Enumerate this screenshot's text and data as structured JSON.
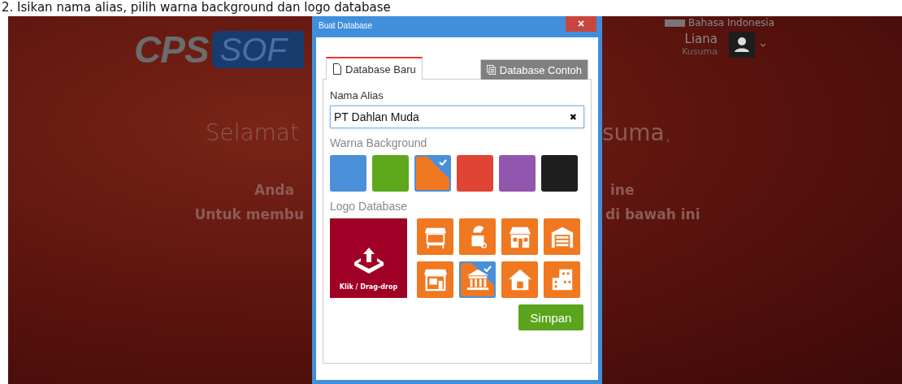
{
  "caption": "2.  Isikan nama alias, pilih warna background dan logo database",
  "header": {
    "logo_left": "CPS",
    "logo_right": "SOF",
    "language": "Bahasa Indonesia",
    "user_first": "Liana",
    "user_last": "Kusuma"
  },
  "welcome": [
    {
      "left": "Selamat",
      "right": "**suma**,"
    },
    {
      "left": "Anda",
      "right": "ine"
    },
    {
      "left": "Untuk membu",
      "right": "di bawah ini"
    }
  ],
  "dialog": {
    "title": "Buat Database",
    "close": "×",
    "tabs": [
      {
        "label": "Database Baru",
        "selected": true
      },
      {
        "label": "Database Contoh",
        "selected": false
      }
    ],
    "alias_label": "Nama Alias",
    "alias_value": "PT Dahlan Muda",
    "clear": "✖",
    "color_label": "Warna Background",
    "colors": [
      {
        "color": "#4a90d9",
        "selected": false
      },
      {
        "color": "#5ea81c",
        "selected": false
      },
      {
        "color": "#f07820",
        "selected": true
      },
      {
        "color": "#e04434",
        "selected": false
      },
      {
        "color": "#9156ad",
        "selected": false
      },
      {
        "color": "#1f1f1f",
        "selected": false
      }
    ],
    "logo_label": "Logo Database",
    "upload": "Klik / Drag-drop",
    "logos": [
      {
        "kind": "stall",
        "selected": false
      },
      {
        "kind": "cart",
        "selected": false
      },
      {
        "kind": "shop",
        "selected": false
      },
      {
        "kind": "garage",
        "selected": false
      },
      {
        "kind": "store",
        "selected": false
      },
      {
        "kind": "bank",
        "selected": true
      },
      {
        "kind": "house",
        "selected": false
      },
      {
        "kind": "building",
        "selected": false
      }
    ],
    "save": "Simpan"
  }
}
